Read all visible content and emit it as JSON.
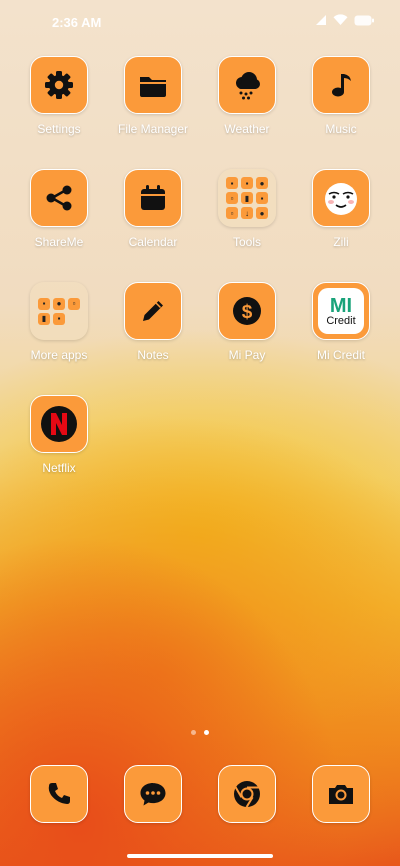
{
  "status": {
    "time": "2:36 AM"
  },
  "apps": [
    {
      "name": "Settings",
      "icon": "gear-icon"
    },
    {
      "name": "File Manager",
      "icon": "folder-icon"
    },
    {
      "name": "Weather",
      "icon": "cloud-rain-icon"
    },
    {
      "name": "Music",
      "icon": "music-note-icon"
    },
    {
      "name": "ShareMe",
      "icon": "share-icon"
    },
    {
      "name": "Calendar",
      "icon": "calendar-icon"
    },
    {
      "name": "Tools",
      "icon": "tools-folder"
    },
    {
      "name": "Zili",
      "icon": "zili-face-icon"
    },
    {
      "name": "More apps",
      "icon": "apps-folder"
    },
    {
      "name": "Notes",
      "icon": "pencil-icon"
    },
    {
      "name": "Mi Pay",
      "icon": "dollar-coin-icon"
    },
    {
      "name": "Mi Credit",
      "icon": "mi-credit-logo",
      "logo_text": "MI",
      "logo_sub": "Credit"
    },
    {
      "name": "Netflix",
      "icon": "netflix-logo"
    }
  ],
  "dock": [
    {
      "name": "Phone",
      "icon": "phone-icon"
    },
    {
      "name": "Messages",
      "icon": "chat-bubble-icon"
    },
    {
      "name": "Chrome",
      "icon": "chrome-icon"
    },
    {
      "name": "Camera",
      "icon": "camera-icon"
    }
  ],
  "pages": {
    "count": 2,
    "current": 2
  },
  "colors": {
    "tile": "#fb9a3a",
    "tile_border": "#ffffff",
    "glyph": "#111111"
  }
}
